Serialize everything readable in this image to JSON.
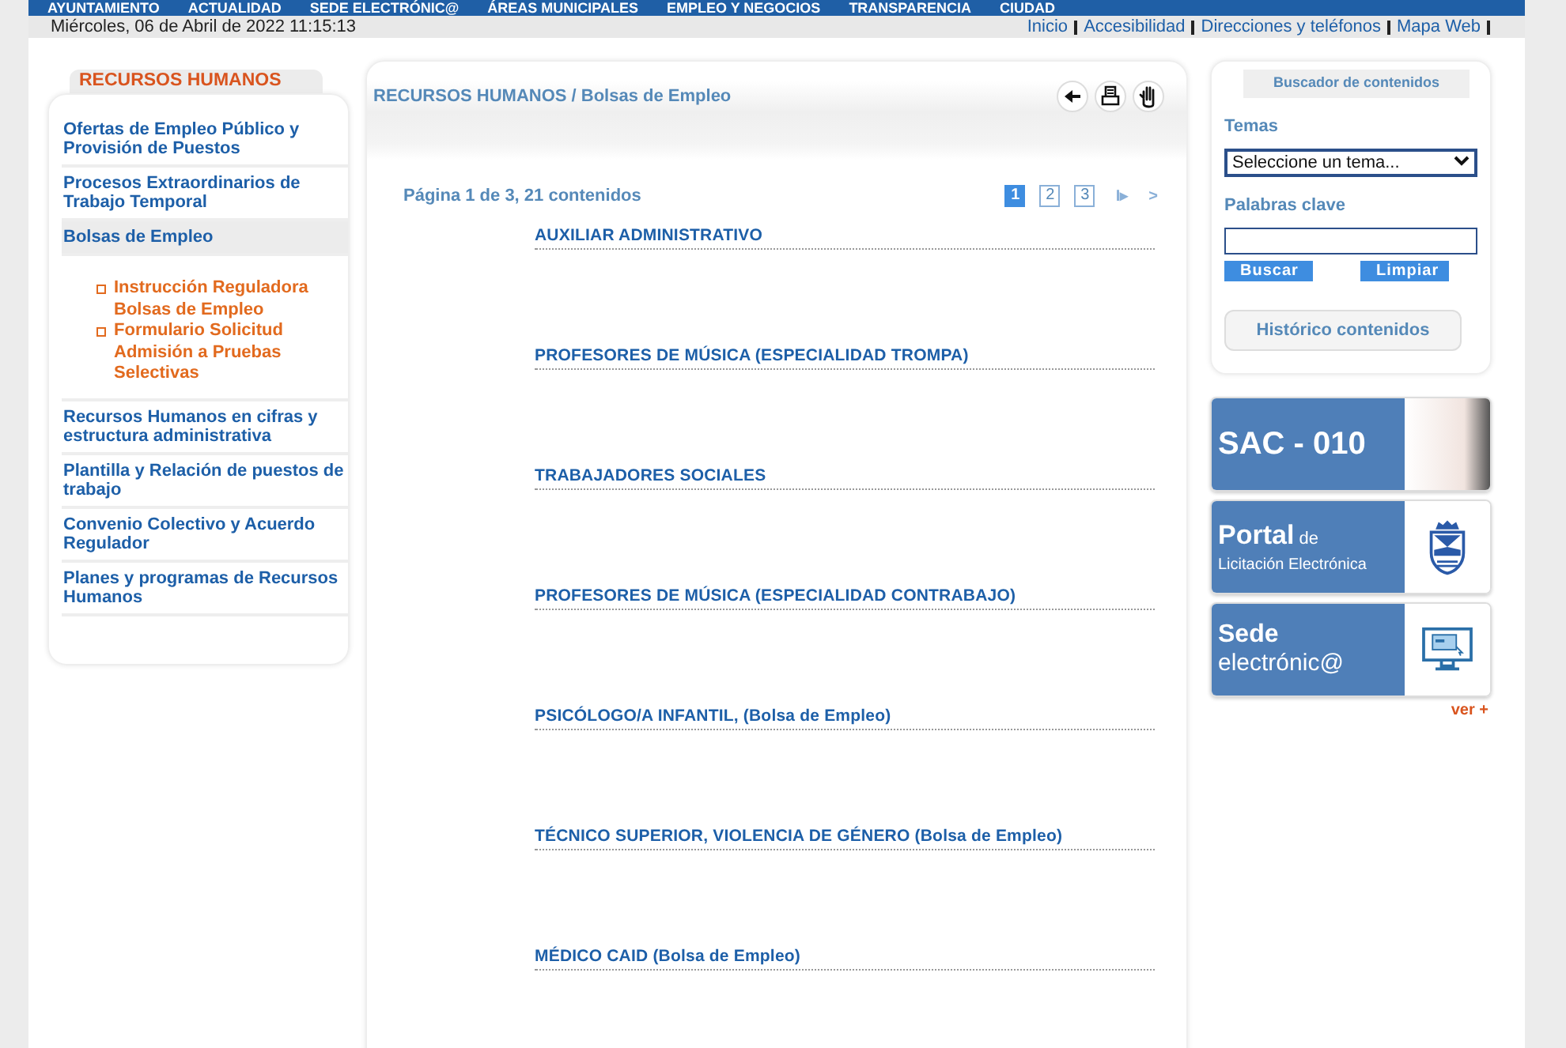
{
  "top_menu": [
    "AYUNTAMIENTO",
    "ACTUALIDAD",
    "SEDE ELECTRÓNIC@",
    "ÁREAS MUNICIPALES",
    "EMPLEO Y NEGOCIOS",
    "TRANSPARENCIA",
    "CIUDAD"
  ],
  "date": "Miércoles, 06 de Abril de 2022 11:15:13",
  "utility_links": [
    "Inicio",
    "Accesibilidad",
    "Direcciones y teléfonos",
    "Mapa Web"
  ],
  "sidebar": {
    "title": "RECURSOS HUMANOS",
    "items": [
      {
        "label": "Ofertas de Empleo Público y Provisión de Puestos",
        "selected": false
      },
      {
        "label": "Procesos Extraordinarios de Trabajo Temporal",
        "selected": false
      },
      {
        "label": "Bolsas de Empleo",
        "selected": true,
        "children": [
          {
            "label": "Instrucción Reguladora Bolsas de Empleo"
          },
          {
            "label": "Formulario Solicitud Admisión a Pruebas Selectivas"
          }
        ]
      },
      {
        "label": "Recursos Humanos en cifras y estructura administrativa",
        "selected": false
      },
      {
        "label": "Plantilla y Relación de puestos de trabajo",
        "selected": false
      },
      {
        "label": "Convenio Colectivo y Acuerdo Regulador",
        "selected": false
      },
      {
        "label": "Planes y programas de Recursos Humanos",
        "selected": false
      }
    ]
  },
  "breadcrumb": "RECURSOS HUMANOS / Bolsas de Empleo",
  "pagination": {
    "summary": "Página 1 de 3, 21 contenidos",
    "pages": [
      {
        "label": "1",
        "selected": true
      },
      {
        "label": "2",
        "selected": false
      },
      {
        "label": "3",
        "selected": false
      }
    ],
    "last": "I▸",
    "next": ">"
  },
  "results": [
    "AUXILIAR ADMINISTRATIVO",
    "PROFESORES DE MÚSICA (ESPECIALIDAD TROMPA)",
    "TRABAJADORES SOCIALES",
    "PROFESORES DE MÚSICA (ESPECIALIDAD CONTRABAJO)",
    "PSICÓLOGO/A INFANTIL, (Bolsa de Empleo)",
    "TÉCNICO SUPERIOR, VIOLENCIA DE GÉNERO (Bolsa de Empleo)",
    "MÉDICO CAID (Bolsa de Empleo)"
  ],
  "search_box": {
    "title": "Buscador de contenidos",
    "topics_label": "Temas",
    "topics_value": "Seleccione un tema...",
    "keywords_label": "Palabras clave",
    "search_button": "Buscar",
    "clear_button": "Limpiar",
    "history_button": "Histórico contenidos"
  },
  "banners": [
    {
      "kind": "sac",
      "title": "SAC - 010"
    },
    {
      "kind": "portal",
      "title": "Portal",
      "small": "de",
      "subtitle": "Licitación Electrónica"
    },
    {
      "kind": "sede",
      "title": "Sede",
      "subtitle": "electrónic@"
    }
  ],
  "more_link": "ver +"
}
